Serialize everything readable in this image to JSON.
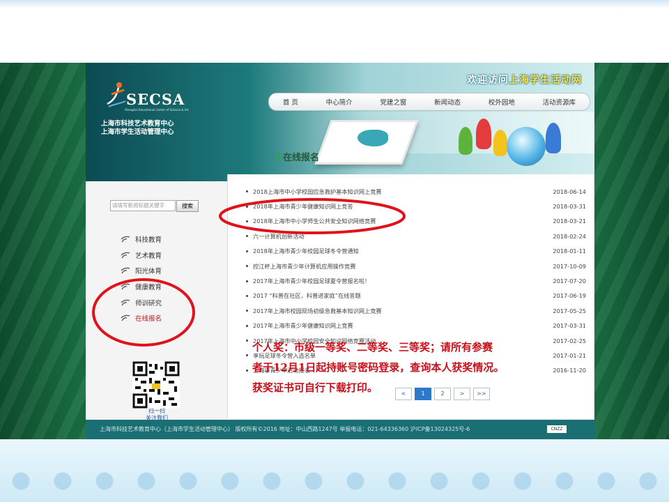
{
  "page": {
    "welcome_prefix": "欢迎访问",
    "welcome_highlight": "上海学生活动网",
    "logo_text": "SECSA",
    "logo_sub": "Shanghai Educational Center of Science & Art",
    "org_line1": "上海市科技艺术教育中心",
    "org_line2": "上海市学生活动管理中心"
  },
  "nav": {
    "items": [
      {
        "label": "首 页"
      },
      {
        "label": "中心简介"
      },
      {
        "label": "党建之窗"
      },
      {
        "label": "新闻动态"
      },
      {
        "label": "校外园地"
      },
      {
        "label": "活动资源库"
      }
    ]
  },
  "section": {
    "title": "在线报名"
  },
  "search": {
    "placeholder": "请填写新闻标题关键字",
    "button": "搜索"
  },
  "sidebar": {
    "items": [
      {
        "label": "科技教育"
      },
      {
        "label": "艺术教育"
      },
      {
        "label": "阳光体育"
      },
      {
        "label": "健康教育"
      },
      {
        "label": "师训研究"
      },
      {
        "label": "在线报名"
      }
    ],
    "qr_line1": "扫一扫",
    "qr_line2": "关注我们"
  },
  "news": [
    {
      "title": "2018上海市中小学校园应急救护基本知识网上竞赛",
      "date": "2018-06-14"
    },
    {
      "title": "2018年上海市青少年健康知识网上竞答",
      "date": "2018-03-31"
    },
    {
      "title": "2018年上海市中小学师生公共安全知识网络竞赛",
      "date": "2018-03-21"
    },
    {
      "title": "六一计算机创新活动",
      "date": "2018-02-24"
    },
    {
      "title": "2018年上海市青少年校园足球冬令营通知",
      "date": "2018-01-11"
    },
    {
      "title": "控江杯上海市青少年计算机应用操作竞赛",
      "date": "2017-10-09"
    },
    {
      "title": "2017年上海市青少年校园足球夏令营报名啦！",
      "date": "2017-07-20"
    },
    {
      "title": "2017 “科普在社区，科普进家庭”在线答题",
      "date": "2017-06-19"
    },
    {
      "title": "2017年上海市校园现场初级急救基本知识网上竞赛",
      "date": "2017-05-25"
    },
    {
      "title": "2017年上海市青少年健康知识网上竞赛",
      "date": "2017-03-31"
    },
    {
      "title": "2017年上海市中小学校园安全知识网络竞赛活动",
      "date": "2017-02-25"
    },
    {
      "title": "享玩足球冬令营入选名单",
      "date": "2017-01-21"
    },
    {
      "title": "上海市青少年活动报名",
      "date": "2016-11-20"
    }
  ],
  "pager": {
    "prev": "<",
    "current": "1",
    "next_page": "2",
    "next": ">",
    "last": ">>"
  },
  "footer": {
    "text": "上海市科技艺术教育中心（上海市学生活动管理中心）  版权所有©2016   地址：中山西路1247号   举报电话：021-64336360          沪ICP备13024325号-6",
    "badge": "CNZZ"
  },
  "annotation": {
    "line1": "个人奖：市级一等奖、二等奖、三等奖；请所有参赛",
    "line2": "者于12月1日起持账号密码登录，查询本人获奖情况。",
    "line3": "获奖证书可自行下载打印。"
  },
  "colors": {
    "annotation_red": "#c8101a",
    "header_teal": "#1d7a7a",
    "slide_green": "#13603a"
  }
}
